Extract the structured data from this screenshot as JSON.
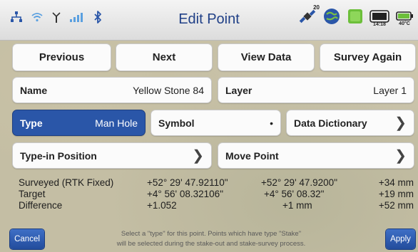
{
  "header": {
    "title": "Edit Point",
    "badge": "20",
    "time": "14:18",
    "temp": "40°C"
  },
  "actions": {
    "previous": "Previous",
    "next": "Next",
    "view_data": "View Data",
    "survey_again": "Survey Again"
  },
  "fields": {
    "name_label": "Name",
    "name_value": "Yellow Stone 84",
    "layer_label": "Layer",
    "layer_value": "Layer 1",
    "type_label": "Type",
    "type_value": "Man Hole",
    "symbol_label": "Symbol",
    "symbol_value": "•",
    "data_dictionary_label": "Data Dictionary",
    "type_in_label": "Type-in Position",
    "move_point_label": "Move Point"
  },
  "coordinates": [
    {
      "label": "Surveyed (RTK Fixed)",
      "lat": "+52° 29' 47.92110\"",
      "lon": "+52° 29' 47.9200\"",
      "h": "+34 mm"
    },
    {
      "label": "Target",
      "lat": "+4° 56' 08.32106\"",
      "lon": "+4° 56' 08.32\"",
      "h": "+19 mm"
    },
    {
      "label": "Difference",
      "lat": "+1.052",
      "lon": "+1 mm",
      "h": "+52 mm"
    }
  ],
  "footer": {
    "cancel": "Cancel",
    "apply": "Apply",
    "hint_line1": "Select a \"type\" for this point. Points which have type \"Stake\"",
    "hint_line2": "will be selected during the stake-out and stake-survey process."
  },
  "colors": {
    "accent": "#2a56a8",
    "title": "#1f3f86"
  }
}
